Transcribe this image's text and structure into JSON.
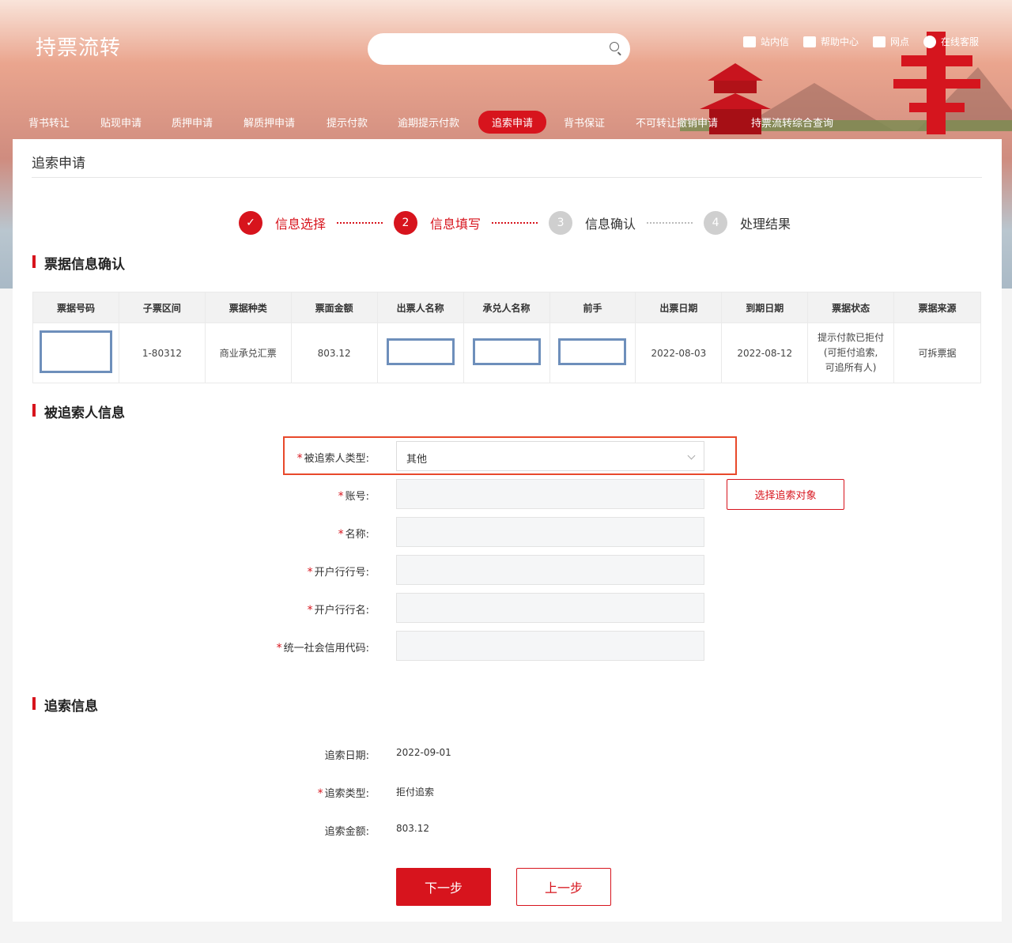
{
  "header": {
    "logo": "持票流转",
    "search_placeholder": "",
    "links": [
      {
        "label": "站内信",
        "icon": "mail-icon"
      },
      {
        "label": "帮助中心",
        "icon": "bookmark-icon"
      },
      {
        "label": "网点",
        "icon": "location-icon"
      },
      {
        "label": "在线客服",
        "icon": "headset-icon"
      }
    ]
  },
  "nav": {
    "items": [
      "背书转让",
      "贴现申请",
      "质押申请",
      "解质押申请",
      "提示付款",
      "逾期提示付款",
      "追索申请",
      "背书保证",
      "不可转让撤销申请",
      "持票流转综合查询"
    ],
    "active_index": 6
  },
  "page": {
    "title": "追索申请"
  },
  "steps": [
    {
      "num": "✓",
      "label": "信息选择",
      "state": "done"
    },
    {
      "num": "2",
      "label": "信息填写",
      "state": "current"
    },
    {
      "num": "3",
      "label": "信息确认",
      "state": "todo"
    },
    {
      "num": "4",
      "label": "处理结果",
      "state": "todo"
    }
  ],
  "bill_section": {
    "title": "票据信息确认",
    "columns": [
      "票据号码",
      "子票区间",
      "票据种类",
      "票面金额",
      "出票人名称",
      "承兑人名称",
      "前手",
      "出票日期",
      "到期日期",
      "票据状态",
      "票据来源"
    ],
    "row": {
      "bill_no": "",
      "sub_range": "1-80312",
      "type": "商业承兑汇票",
      "amount": "803.12",
      "drawer": "",
      "acceptor": "",
      "prior": "",
      "issue_date": "2022-08-03",
      "due_date": "2022-08-12",
      "status_line1": "提示付款已拒付",
      "status_line2": "(可拒付追索,",
      "status_line3": "可追所有人)",
      "source": "可拆票据"
    }
  },
  "recourse_party": {
    "title": "被追索人信息",
    "type_label": "被追索人类型:",
    "type_value": "其他",
    "account_label": "账号:",
    "name_label": "名称:",
    "bank_no_label": "开户行行号:",
    "bank_name_label": "开户行行名:",
    "credit_code_label": "统一社会信用代码:",
    "select_button": "选择追索对象"
  },
  "recourse_info": {
    "title": "追索信息",
    "date_label": "追索日期:",
    "date_value": "2022-09-01",
    "type_label": "追索类型:",
    "type_value": "拒付追索",
    "amount_label": "追索金额:",
    "amount_value": "803.12"
  },
  "buttons": {
    "next": "下一步",
    "prev": "上一步"
  },
  "colors": {
    "accent": "#d7141d",
    "highlight_box": "#e8492b"
  }
}
